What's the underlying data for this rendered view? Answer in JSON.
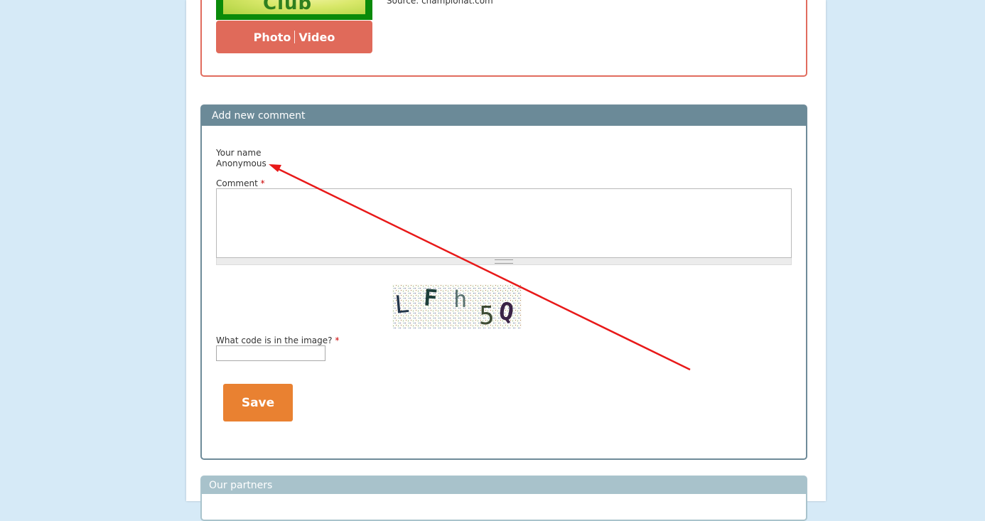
{
  "media": {
    "thumb_text": "Club",
    "source_text": "Source: championat.com",
    "photo_label": "Photo",
    "video_label": "Video"
  },
  "comment_form": {
    "header": "Add new comment",
    "name_label": "Your name",
    "name_value": "Anonymous",
    "comment_label": "Comment",
    "required_mark": "*",
    "comment_value": "",
    "captcha_code": "LFh5Q",
    "captcha_chars": [
      "L",
      "F",
      "h",
      "5",
      "Q"
    ],
    "code_label": "What code is in the image?",
    "code_value": "",
    "save_label": "Save"
  },
  "partners": {
    "header": "Our partners"
  },
  "colors": {
    "page_bg": "#d6eaf7",
    "media_border": "#e16c5e",
    "photo_button": "#e06a5a",
    "comment_header": "#6b8a98",
    "save_button": "#e98131",
    "partners_header": "#a8c2cb",
    "annotation_arrow": "#e81919"
  }
}
